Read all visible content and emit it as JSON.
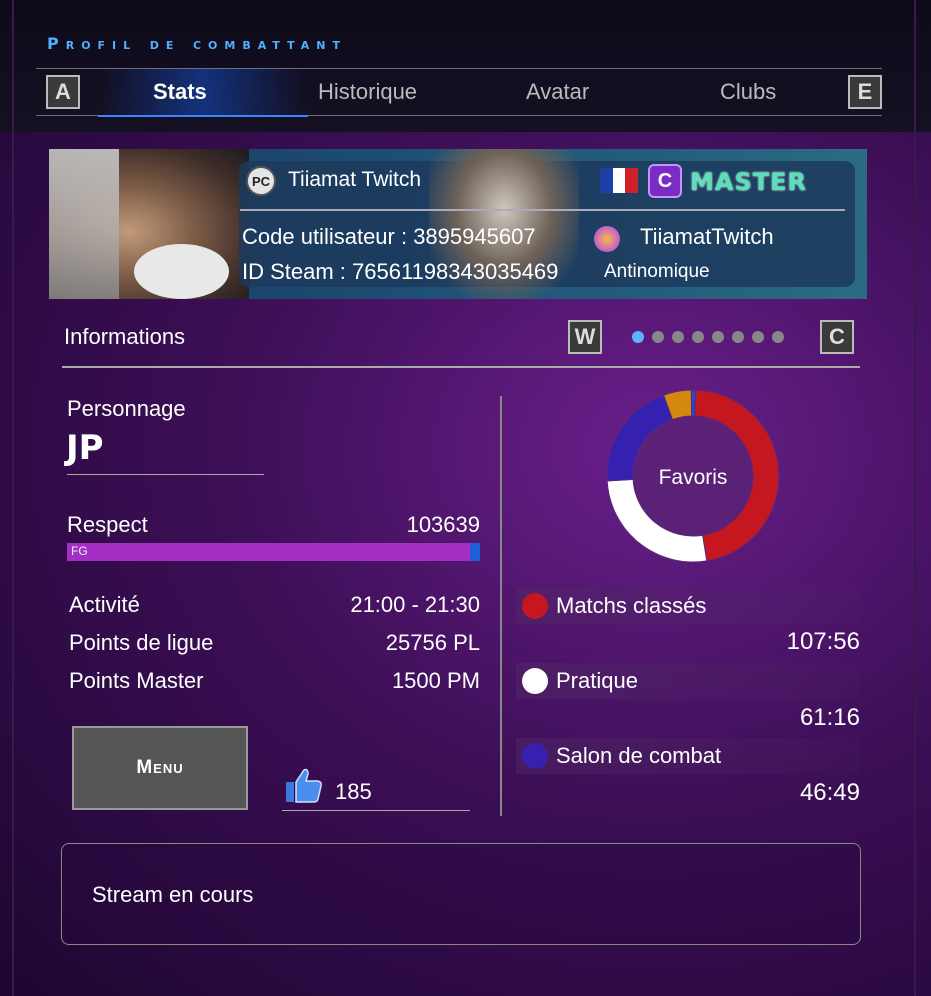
{
  "header": {
    "title": "Profil de combattant"
  },
  "tabs": {
    "left_key": "A",
    "right_key": "E",
    "items": [
      {
        "label": "Stats"
      },
      {
        "label": "Historique"
      },
      {
        "label": "Avatar"
      },
      {
        "label": "Clubs"
      }
    ],
    "active": "Stats"
  },
  "profile": {
    "platform_badge": "PC",
    "username": "Tiiamat Twitch",
    "user_code_label": "Code utilisateur : 3895945607",
    "steam_id_label": "ID Steam : 76561198343035469",
    "rank_letter": "C",
    "rank_name": "MASTER",
    "club_name": "TiiamatTwitch",
    "title": "Antinomique",
    "flag_colors": [
      "#1f3fa8",
      "#ffffff",
      "#d0202a"
    ]
  },
  "info": {
    "header": "Informations",
    "left_key": "W",
    "right_key": "C",
    "page_count": 8,
    "active_page": 1
  },
  "character": {
    "label": "Personnage",
    "name": "JP"
  },
  "respect": {
    "label": "Respect",
    "value": "103639",
    "tier": "FG",
    "fill_fraction": 0.98
  },
  "stats": [
    {
      "label": "Activité",
      "value": "21:00 - 21:30"
    },
    {
      "label": "Points de ligue",
      "value": "25756 PL"
    },
    {
      "label": "Points Master",
      "value": "1500 PM"
    }
  ],
  "menu_button": {
    "label": "Menu"
  },
  "likes": {
    "count": "185"
  },
  "chart_data": {
    "type": "pie",
    "title": "Favoris",
    "slices": [
      {
        "name": "Matchs classés",
        "value": "107:56",
        "minutes": 6476,
        "color": "#c4171f"
      },
      {
        "name": "Pratique",
        "value": "61:16",
        "minutes": 3676,
        "color": "#ffffff"
      },
      {
        "name": "Salon de combat",
        "value": "46:49",
        "minutes": 2809,
        "color": "#3520b0"
      },
      {
        "name": "",
        "minutes": 720,
        "color": "#d4880e"
      },
      {
        "name": "",
        "minutes": 110,
        "color": "#1e4ad4"
      }
    ]
  },
  "stream": {
    "label": "Stream en cours"
  }
}
